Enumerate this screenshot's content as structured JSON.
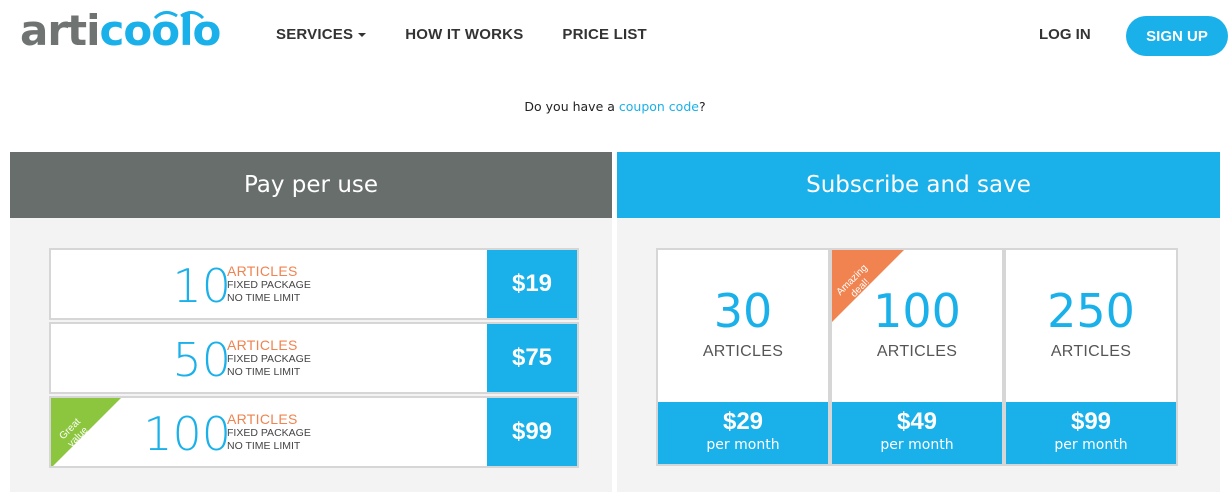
{
  "brand": {
    "part1": "arti",
    "part2": "coolo"
  },
  "nav": {
    "items": [
      {
        "label": "SERVICES",
        "has_dropdown": true
      },
      {
        "label": "HOW IT WORKS",
        "has_dropdown": false
      },
      {
        "label": "PRICE LIST",
        "has_dropdown": false
      }
    ],
    "login": "LOG IN",
    "signup": "SIGN UP"
  },
  "coupon": {
    "prefix": "Do you have a ",
    "link": "coupon code",
    "suffix": "?"
  },
  "pay_per_use": {
    "title": "Pay per use",
    "rows": [
      {
        "qty": "10",
        "kind": "ARTICLES",
        "line1": "FIXED PACKAGE",
        "line2": "NO TIME LIMIT",
        "price": "$19",
        "badge": ""
      },
      {
        "qty": "50",
        "kind": "ARTICLES",
        "line1": "FIXED PACKAGE",
        "line2": "NO TIME LIMIT",
        "price": "$75",
        "badge": ""
      },
      {
        "qty": "100",
        "kind": "ARTICLES",
        "line1": "FIXED PACKAGE",
        "line2": "NO TIME LIMIT",
        "price": "$99",
        "badge_line1": "Great",
        "badge_line2": "value"
      }
    ]
  },
  "subscribe": {
    "title": "Subscribe and save",
    "cards": [
      {
        "qty": "30",
        "kind": "ARTICLES",
        "price": "$29",
        "period": "per month"
      },
      {
        "qty": "100",
        "kind": "ARTICLES",
        "price": "$49",
        "period": "per month",
        "badge_line1": "Amazing",
        "badge_line2": "deal!"
      },
      {
        "qty": "250",
        "kind": "ARTICLES",
        "price": "$99",
        "period": "per month"
      }
    ]
  },
  "colors": {
    "accent": "#1ab0ea",
    "orange": "#f0834f",
    "green": "#8cc63f",
    "gray_header": "#676e6b"
  }
}
